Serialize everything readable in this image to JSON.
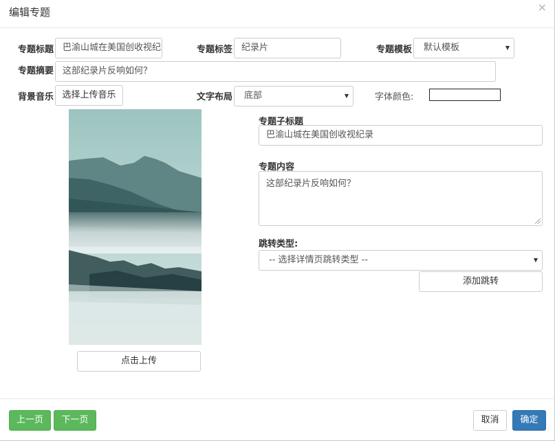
{
  "dialog": {
    "title": "编辑专题",
    "close_icon": "×"
  },
  "form": {
    "title_label": "专题标题",
    "title_value": "巴渝山城在美国创收视纪录",
    "tag_label": "专题标签",
    "tag_value": "纪录片",
    "template_label": "专题模板",
    "template_value": "默认模板",
    "summary_label": "专题摘要",
    "summary_value": "这部纪录片反响如何？",
    "music_label": "背景音乐",
    "music_button": "选择上传音乐",
    "layout_label": "文字布局",
    "layout_value": "底部",
    "font_color_label": "字体颜色:",
    "upload_button": "点击上传",
    "subtitle_label": "专题子标题",
    "subtitle_value": "巴渝山城在美国创收视纪录",
    "content_label": "专题内容",
    "content_value": "这部纪录片反响如何？",
    "jump_type_label": "跳转类型:",
    "jump_type_placeholder": "-- 选择详情页跳转类型 --",
    "add_jump_button": "添加跳转"
  },
  "footer": {
    "prev_button": "上一页",
    "next_button": "下一页",
    "cancel_button": "取消",
    "confirm_button": "确定"
  },
  "icons": {
    "caret": "▼",
    "close": "close-icon",
    "resize": "resize-grip-icon"
  },
  "colors": {
    "green": "#5cb85c",
    "blue": "#337ab7",
    "border": "#cccccc"
  }
}
